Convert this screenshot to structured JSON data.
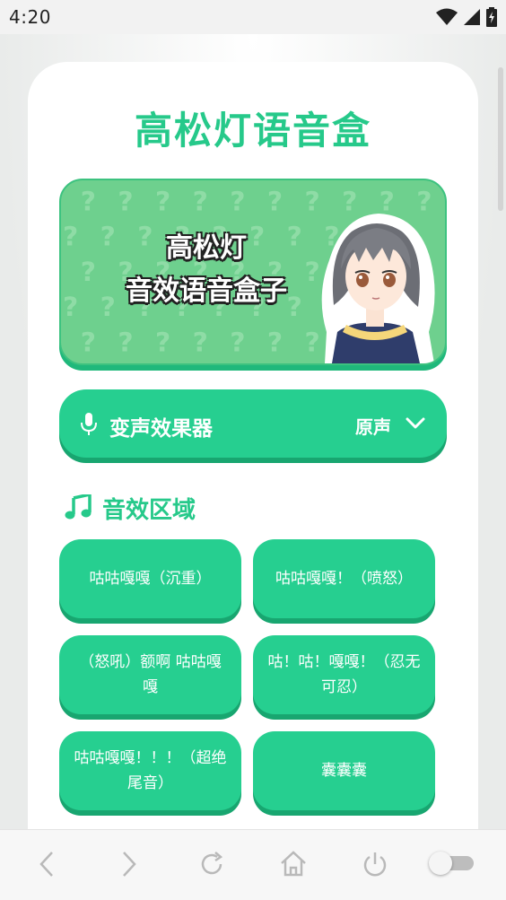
{
  "status_bar": {
    "time": "4:20"
  },
  "app": {
    "title": "高松灯语音盒"
  },
  "banner": {
    "line1": "高松灯",
    "line2": "音效语音盒子"
  },
  "voice_changer": {
    "label": "变声效果器",
    "value": "原声"
  },
  "sound_section": {
    "title": "音效区域",
    "buttons": [
      {
        "label": "咕咕嘎嘎（沉重）"
      },
      {
        "label": "咕咕嘎嘎！（喷怒）"
      },
      {
        "label": "（怒吼）额啊 咕咕嘎嘎"
      },
      {
        "label": "咕！咕！嘎嘎！（忍无可忍）"
      },
      {
        "label": "咕咕嘎嘎！！！（超绝尾音）"
      },
      {
        "label": "囊囊囊"
      }
    ]
  },
  "colors": {
    "accent": "#26c98a",
    "button": "#26cf90",
    "button_shadow": "#18a670",
    "banner_bg": "#6ed08e"
  },
  "icons": {
    "status": [
      "wifi-icon",
      "signal-icon",
      "battery-icon"
    ],
    "nav": [
      "back-icon",
      "forward-icon",
      "reload-icon",
      "home-icon",
      "power-icon"
    ],
    "voice": "microphone-icon",
    "section": "music-note-icon"
  }
}
